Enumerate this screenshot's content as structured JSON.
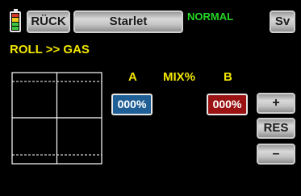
{
  "header": {
    "back_label": "RÜCK",
    "model_name": "Starlet",
    "phase_label": "NORMAL",
    "servo_label": "Sv",
    "battery_colors": [
      "#d83a2a",
      "#f0c81e",
      "#3ec43e",
      "#3ec43e"
    ]
  },
  "page": {
    "title": "ROLL >> GAS"
  },
  "mixer": {
    "col_a_label": "A",
    "mix_label": "MIX%",
    "col_b_label": "B",
    "value_a": "000%",
    "value_b": "000%",
    "colors": {
      "value_a_bg": "#1f5f96",
      "value_b_bg": "#9a1212"
    }
  },
  "side_buttons": {
    "plus_label": "+",
    "reset_label": "RES",
    "minus_label": "–"
  },
  "colors": {
    "background": "#000000",
    "title_yellow": "#f2e600",
    "phase_green": "#24d624"
  }
}
